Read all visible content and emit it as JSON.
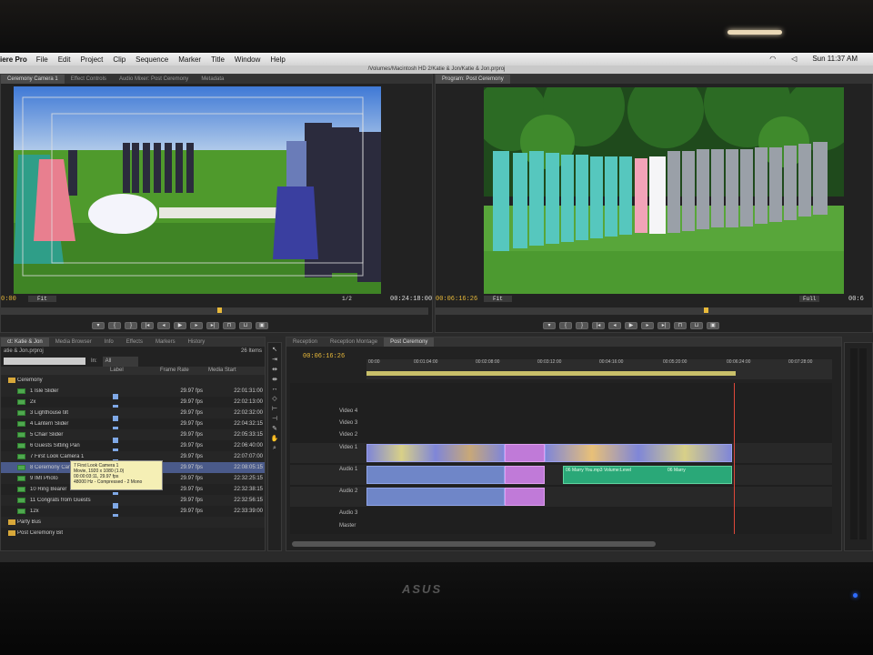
{
  "menubar": {
    "app": "iere Pro",
    "items": [
      "File",
      "Edit",
      "Project",
      "Clip",
      "Sequence",
      "Marker",
      "Title",
      "Window",
      "Help"
    ],
    "time": "Sun 11:37 AM"
  },
  "path": "/Volumes/Macintosh HD 2/Katie & Jon/Katie & Jon.prproj",
  "source": {
    "tabs": [
      "Ceremony Camera 1",
      "Effect Controls",
      "Audio Mixer: Post Ceremony",
      "Metadata"
    ],
    "tc_left": "0:00",
    "zoom": "Fit",
    "page": "1/2",
    "tc_right": "00:24:18:00"
  },
  "program": {
    "tab": "Program: Post Ceremony",
    "tc_left": "00:06:16:26",
    "zoom": "Fit",
    "quality": "Full",
    "tc_right": "00:6"
  },
  "project": {
    "tabs": [
      "ct: Katie & Jon",
      "Media Browser",
      "Info",
      "Effects",
      "Markers",
      "History"
    ],
    "file": "atie & Jon.prproj",
    "count": "26 Items",
    "in_label": "In:",
    "in_value": "All",
    "headers": [
      "Label",
      "Frame Rate",
      "Media Start"
    ],
    "folder": "Ceremony",
    "rows": [
      {
        "name": "1 Isle Slider",
        "fr": "29.97 fps",
        "st": "22:01:31:00"
      },
      {
        "name": "2x",
        "fr": "29.97 fps",
        "st": "22:02:13:00"
      },
      {
        "name": "3 Lighthouse tilt",
        "fr": "29.97 fps",
        "st": "22:02:32:00"
      },
      {
        "name": "4 Lantern Slider",
        "fr": "29.97 fps",
        "st": "22:04:32:15"
      },
      {
        "name": "5 Chair Slider",
        "fr": "29.97 fps",
        "st": "22:05:33:15"
      },
      {
        "name": "6 Guests Sitting Pan",
        "fr": "29.97 fps",
        "st": "22:06:40:00"
      },
      {
        "name": "7 First Look Camera 1",
        "fr": "29.97 fps",
        "st": "22:07:07:00"
      },
      {
        "name": "8 Ceremony Camera 1",
        "fr": "29.97 fps",
        "st": "22:08:05:15"
      },
      {
        "name": "9 IMI Photo",
        "fr": "29.97 fps",
        "st": "22:32:25:15"
      },
      {
        "name": "10 Ring Bearer",
        "fr": "29.97 fps",
        "st": "22:32:38:15"
      },
      {
        "name": "11 Congrats from Guests",
        "fr": "29.97 fps",
        "st": "22:32:56:15"
      },
      {
        "name": "12x",
        "fr": "29.97 fps",
        "st": "22:33:39:00"
      }
    ],
    "subfolders": [
      "Party Bus",
      "Post Ceremony Bit"
    ],
    "tooltip": [
      "7 First Look Camera 1",
      "Movie, 1920 x 1080 (1.0)",
      "00:00:03:11, 29.97 fps",
      "48000 Hz - Compressed - 2 Mono"
    ]
  },
  "timeline": {
    "tabs": [
      "Reception",
      "Reception Montage",
      "Post Ceremony"
    ],
    "tc": "00:06:16:26",
    "ruler": [
      "00:00",
      "00:01:04:00",
      "00:02:08:00",
      "00:03:12:00",
      "00:04:16:00",
      "00:05:20:00",
      "00:06:24:00",
      "00:07:28:00"
    ],
    "tracks": {
      "v4": "Video 4",
      "v3": "Video 3",
      "v2": "Video 2",
      "v1": "Video 1",
      "a1": "Audio 1",
      "a2": "Audio 2",
      "a3": "Audio 3",
      "master": "Master"
    },
    "green_clip": "06 Marry You.mp3 Volume:Level",
    "green_clip2": "06 Marry"
  },
  "colors": {
    "accent": "#e8b93a",
    "playhead": "#e0483a",
    "clip_video": "#7f86d8",
    "clip_audio_green": "#2aa878",
    "label": "#7fa8e6"
  },
  "monitor_brand": "ASUS"
}
